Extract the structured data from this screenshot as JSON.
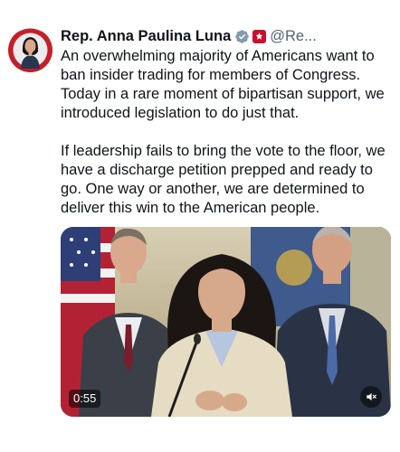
{
  "tweet": {
    "author_name": "Rep. Anna Paulina Luna",
    "handle": "@Re...",
    "paragraphs": [
      "An overwhelming majority of Americans want to ban insider trading for members of Congress. Today in a rare moment of bipartisan support, we introduced legislation to do just that.",
      "If leadership fails to bring the vote to the floor, we have a discharge petition prepped and ready to go. One way or another, we are determined to deliver this win to the American people."
    ],
    "icons": {
      "avatar": "avatar-icon",
      "verified": "verified-badge-icon",
      "affiliation": "government-affiliation-icon",
      "mute": "muted-speaker-icon"
    }
  },
  "video": {
    "duration": "0:55"
  },
  "colors": {
    "text": "#0f1419",
    "secondary": "#536471",
    "verified": "#829aab",
    "affiliation": "#c8102e"
  }
}
